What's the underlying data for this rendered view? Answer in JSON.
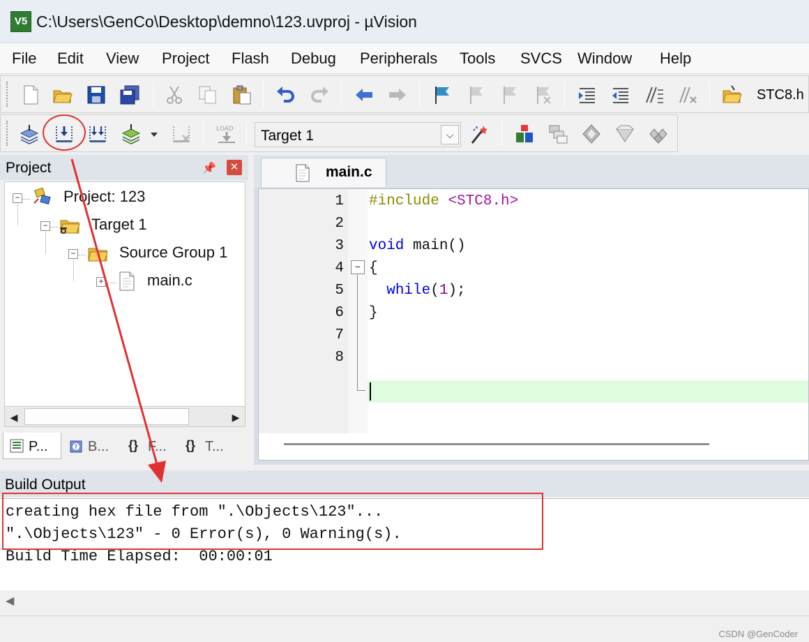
{
  "window": {
    "title": "C:\\Users\\GenCo\\Desktop\\demno\\123.uvproj - µVision",
    "app_icon_text": "V5"
  },
  "menu": {
    "items": [
      "File",
      "Edit",
      "View",
      "Project",
      "Flash",
      "Debug",
      "Peripherals",
      "Tools",
      "SVCS",
      "Window",
      "Help"
    ]
  },
  "toolbar": {
    "header_file": "STC8.h",
    "target_select": "Target 1",
    "load_label": "LOAD"
  },
  "project_pane": {
    "title": "Project",
    "tree": [
      {
        "label": "Project: 123",
        "icon": "project-icon",
        "toggle": "−"
      },
      {
        "label": "Target 1",
        "icon": "target-folder-icon",
        "toggle": "−"
      },
      {
        "label": "Source Group 1",
        "icon": "folder-icon",
        "toggle": "−"
      },
      {
        "label": "main.c",
        "icon": "c-file-icon",
        "toggle": "+"
      }
    ],
    "tabs": [
      {
        "label": "P...",
        "icon": "project-tab-icon",
        "active": true
      },
      {
        "label": "B...",
        "icon": "books-tab-icon",
        "active": false
      },
      {
        "label": "F...",
        "icon": "functions-tab-icon",
        "active": false
      },
      {
        "label": "T...",
        "icon": "templates-tab-icon",
        "active": false
      }
    ],
    "tab_glyphs": {
      "functions": "{}",
      "templates": "{}"
    }
  },
  "editor": {
    "tab_label": "main.c",
    "line_numbers": [
      "1",
      "2",
      "3",
      "4",
      "5",
      "6",
      "7",
      "8"
    ],
    "code": {
      "l1_directive": "#include",
      "l1_header": "<STC8.h>",
      "l3_type": "void",
      "l3_rest": " main()",
      "l4": "{",
      "l5_indent": "  ",
      "l5_kw": "while",
      "l5_open": "(",
      "l5_num": "1",
      "l5_close": ");",
      "l6": "}"
    },
    "fold_marker": "−",
    "active_line": 8
  },
  "build_output": {
    "title": "Build Output",
    "lines": [
      "creating hex file from \".\\Objects\\123\"...",
      "\".\\Objects\\123\" - 0 Error(s), 0 Warning(s).",
      "Build Time Elapsed:  00:00:01"
    ]
  },
  "watermark": "CSDN @GenCoder",
  "colors": {
    "annotation": "#e03131",
    "keyword": "#0000e6",
    "preprocessor": "#8b8b00",
    "string": "#a1169c",
    "active_line_bg": "#e0fce0"
  }
}
